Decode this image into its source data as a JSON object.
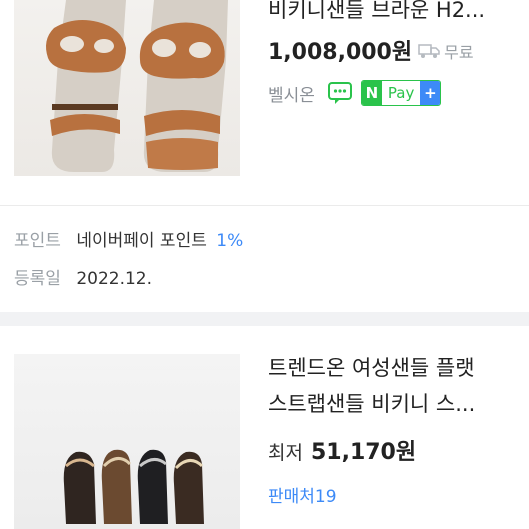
{
  "product1": {
    "title": "비키니샌들 브라운 H2...",
    "price": "1,008,000원",
    "shipping": "무료",
    "seller": "벨시온",
    "npay_n": "N",
    "npay_pay": "Pay",
    "npay_plus": "+",
    "point_label": "포인트",
    "point_value": "네이버페이 포인트",
    "point_pct": "1%",
    "date_label": "등록일",
    "date_value": "2022.12."
  },
  "product2": {
    "title_line1": "트렌드온 여성샌들 플랫",
    "title_line2": "스트랩샌들 비키니 스...",
    "lowest_label": "최저",
    "price": "51,170원",
    "sellers": "판매처19"
  },
  "colors": {
    "accent_blue": "#3d8af7",
    "npay_green": "#2ac34b",
    "muted_text": "#9aa0a6",
    "sandal_brown": "#b8713f",
    "divider": "#f1f2f4"
  },
  "icons": [
    "truck-icon",
    "talk-icon",
    "npay-badge"
  ]
}
